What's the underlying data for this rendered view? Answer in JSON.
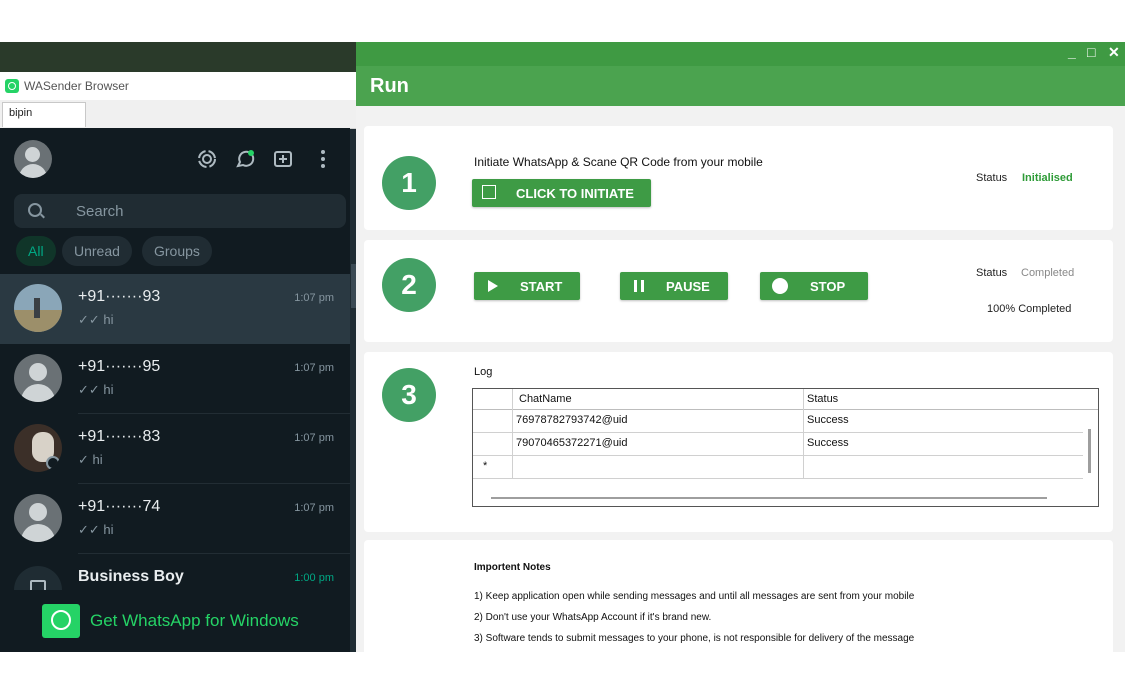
{
  "wa_browser": {
    "window_title": "WASender Browser",
    "tab_label": "bipin",
    "search_placeholder": "Search",
    "filters": [
      "All",
      "Unread",
      "Groups"
    ],
    "chats": [
      {
        "name": "+91·······93",
        "time": "1:07 pm",
        "message": "✓✓ hi",
        "avatar": "photo"
      },
      {
        "name": "+91·······95",
        "time": "1:07 pm",
        "message": "✓✓ hi",
        "avatar": "default"
      },
      {
        "name": "+91·······83",
        "time": "1:07 pm",
        "message": "✓ hi",
        "avatar": "photo"
      },
      {
        "name": "+91·······74",
        "time": "1:07 pm",
        "message": "✓✓ hi",
        "avatar": "default"
      },
      {
        "name": "Business Boy",
        "time": "1:00 pm",
        "message": "",
        "avatar": "business"
      }
    ],
    "banner_text": "Get WhatsApp for Windows"
  },
  "run": {
    "title": "Run",
    "window_controls": [
      "_",
      "□",
      "✕"
    ],
    "step1": {
      "number": "1",
      "instruction": "Initiate WhatsApp & Scane QR Code from your mobile",
      "button": "CLICK TO INITIATE",
      "status_label": "Status",
      "status_value": "Initialised"
    },
    "step2": {
      "number": "2",
      "start": "START",
      "pause": "PAUSE",
      "stop": "STOP",
      "status_label": "Status",
      "status_value": "Completed",
      "progress": "100% Completed"
    },
    "step3": {
      "number": "3",
      "log_label": "Log",
      "columns": [
        "ChatName",
        "Status"
      ],
      "rows": [
        [
          "76978782793742@uid",
          "Success"
        ],
        [
          "79070465372271@uid",
          "Success"
        ]
      ],
      "new_row_marker": "*"
    },
    "notes": {
      "title": "Importent Notes",
      "items": [
        "1) Keep application open while sending messages and until all messages are sent from your mobile",
        "2) Don't use your WhatsApp Account if it's brand new.",
        "3) Software tends to submit messages to your phone, is not responsible for delivery of the message"
      ]
    }
  },
  "colors": {
    "accent_green": "#3e9b45",
    "wa_dark": "#111b21",
    "wa_green": "#25d366",
    "status_green": "#2e9b37"
  }
}
